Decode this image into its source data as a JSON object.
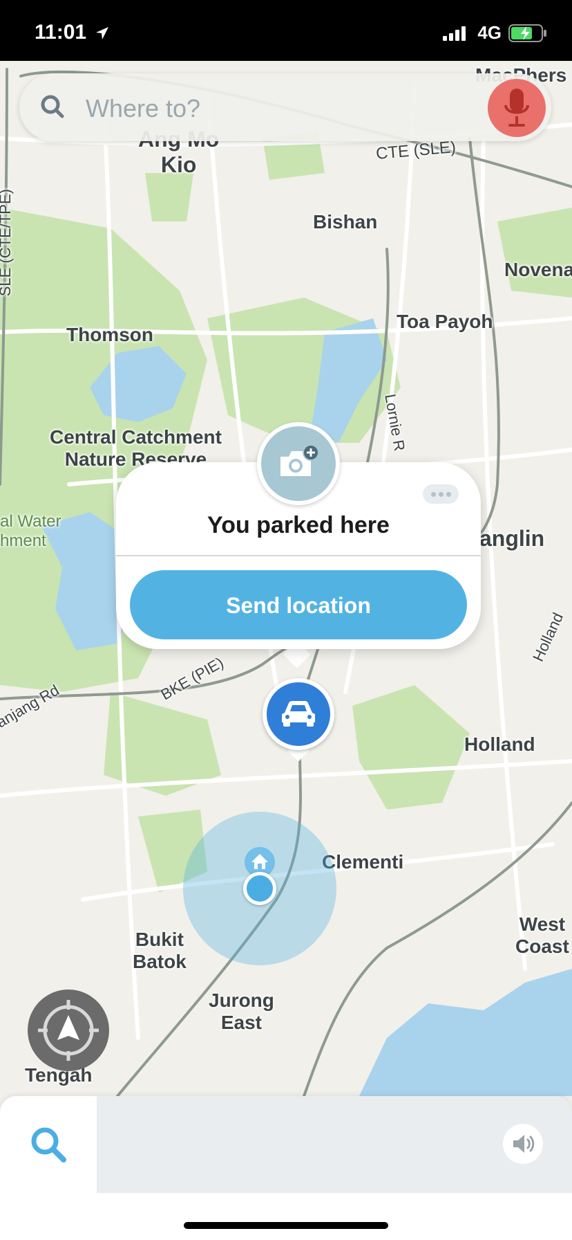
{
  "status_bar": {
    "time": "11:01",
    "network": "4G"
  },
  "search": {
    "placeholder": "Where to?"
  },
  "map": {
    "labels": {
      "ang_mo_kio": "Ang Mo\nKio",
      "bishan": "Bishan",
      "novena": "Novena",
      "thomson": "Thomson",
      "toa_payoh": "Toa Payoh",
      "central_catchment": "Central Catchment\nNature Reserve",
      "central_water": "al Water\nhment",
      "tanglin": "anglin",
      "holland": "Holland",
      "clementi": "Clementi",
      "bukit_batok": "Bukit\nBatok",
      "jurong_east": "Jurong\nEast",
      "west_coast": "West\nCoast",
      "tengah": "Tengah",
      "macpherson": "MacPhers",
      "cte": "CTE (SLE)",
      "bke": "BKE (PIE)",
      "lornie": "Lornie R",
      "anjang_rd": "anjang Rd",
      "sle_cte": "SLE (CTE/TPE)",
      "holland_rd": "Holland"
    }
  },
  "popup": {
    "title": "You parked here",
    "send_button_label": "Send location"
  },
  "colors": {
    "accent_blue": "#52b3e3",
    "car_pin_blue": "#2f7ed8",
    "mic_red": "#e9706b",
    "park_green": "#c9e4b1",
    "water_blue": "#a9d3ec"
  },
  "icons": {
    "search": "search-icon",
    "mic": "microphone-icon",
    "camera": "camera-add-icon",
    "car": "car-icon",
    "home": "home-icon",
    "recenter": "navigation-arrow-icon",
    "sound": "speaker-icon",
    "more": "more-dots-icon"
  }
}
